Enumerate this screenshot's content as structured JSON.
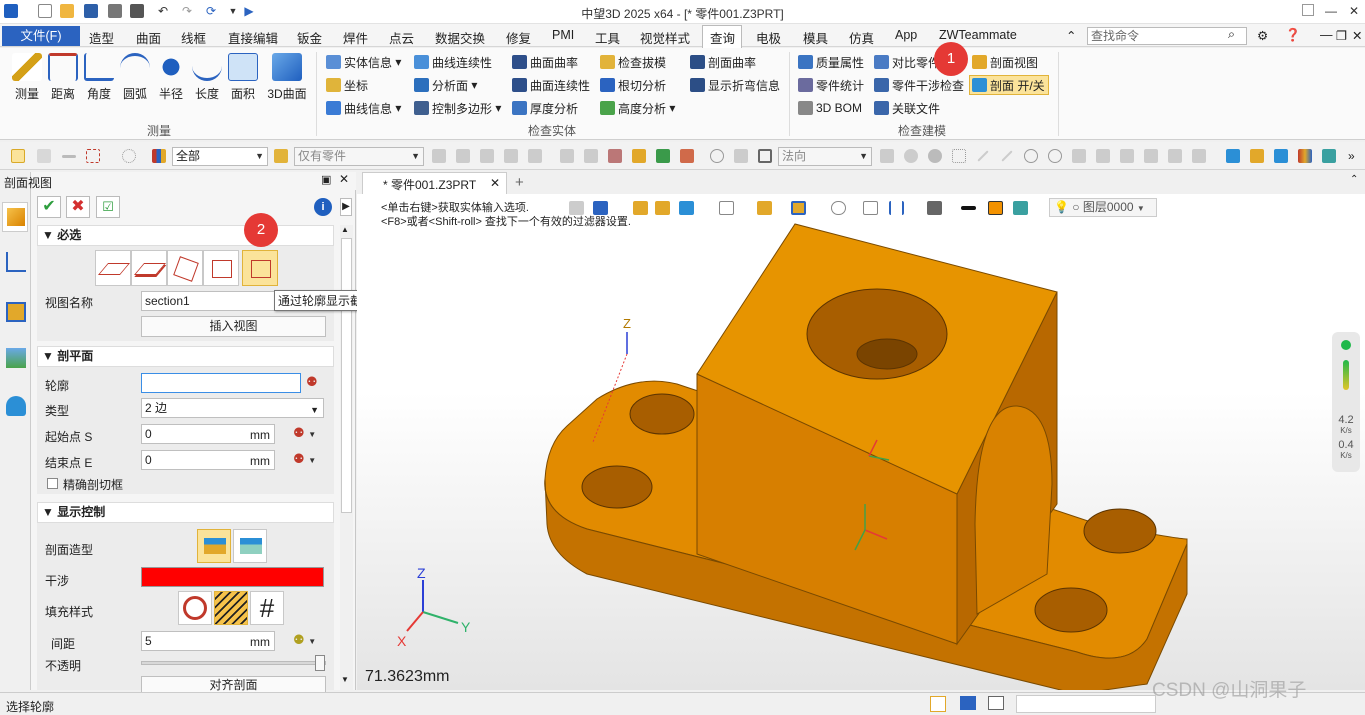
{
  "window": {
    "title": "中望3D 2025 x64 - [* 零件001.Z3PRT]"
  },
  "menu": {
    "file": "文件(F)",
    "items": [
      "造型",
      "曲面",
      "线框",
      "直接编辑",
      "钣金",
      "焊件",
      "点云",
      "数据交换",
      "修复",
      "PMI",
      "工具",
      "视觉样式",
      "查询",
      "电极",
      "模具",
      "仿真",
      "App",
      "ZWTeammate"
    ],
    "active": "查询",
    "search_placeholder": "查找命令"
  },
  "ribbon": {
    "measure_group": {
      "label": "测量",
      "buttons": [
        "测量",
        "距离",
        "角度",
        "圆弧",
        "半径",
        "长度",
        "面积",
        "3D曲面"
      ]
    },
    "check_entity_group": {
      "label": "检查实体",
      "col1": [
        "实体信息",
        "坐标",
        "曲线信息"
      ],
      "col2": [
        "曲线连续性",
        "分析面",
        "控制多边形"
      ],
      "col3": [
        "曲面曲率",
        "曲面连续性",
        "厚度分析"
      ],
      "col4": [
        "检查拔模",
        "根切分析",
        "高度分析"
      ],
      "col5": [
        "剖面曲率",
        "显示折弯信息"
      ]
    },
    "check_model_group": {
      "label": "检查建模",
      "col1": [
        "质量属性",
        "零件统计",
        "3D BOM"
      ],
      "col2": [
        "对比零件",
        "零件干涉检查",
        "关联文件"
      ],
      "col3": [
        "剖面视图",
        "剖面 开/关"
      ]
    }
  },
  "toolbar": {
    "filter_all": "全部",
    "filter_part": "仅有零件",
    "direction": "法向"
  },
  "panel": {
    "title": "剖面视图",
    "required": {
      "header": "必选",
      "view_name_label": "视图名称",
      "view_name_value": "section1",
      "insert_view": "插入视图",
      "tooltip": "通过轮廓显示截面"
    },
    "plane": {
      "header": "剖平面",
      "profile_label": "轮廓",
      "profile_value": "",
      "type_label": "类型",
      "type_value": "2 边",
      "start_label": "起始点 S",
      "start_value": "0",
      "end_label": "结束点 E",
      "end_value": "0",
      "unit": "mm",
      "precise_label": "精确剖切框"
    },
    "display": {
      "header": "显示控制",
      "style_label": "剖面造型",
      "interference_label": "干涉",
      "interference_color": "#ff0000",
      "fill_label": "填充样式",
      "spacing_label": "间距",
      "spacing_value": "5",
      "opacity_label": "不透明",
      "align_button": "对齐剖面"
    }
  },
  "viewport": {
    "tab": "* 零件001.Z3PRT",
    "msg1": "<单击右键>获取实体输入选项.",
    "msg2": "<F8>或者<Shift-roll> 查找下一个有效的过滤器设置.",
    "layer": "图层0000",
    "scale": "71.3623mm",
    "axis_z": "Z",
    "axis_x": "X",
    "axis_y": "Y",
    "speed_up": "4.2",
    "speed_down": "0.4",
    "speed_unit": "K/s",
    "part_color": "#d98200"
  },
  "status": {
    "text": "选择轮廓"
  },
  "badges": [
    "1",
    "2"
  ],
  "watermark": "CSDN @山洞果子"
}
